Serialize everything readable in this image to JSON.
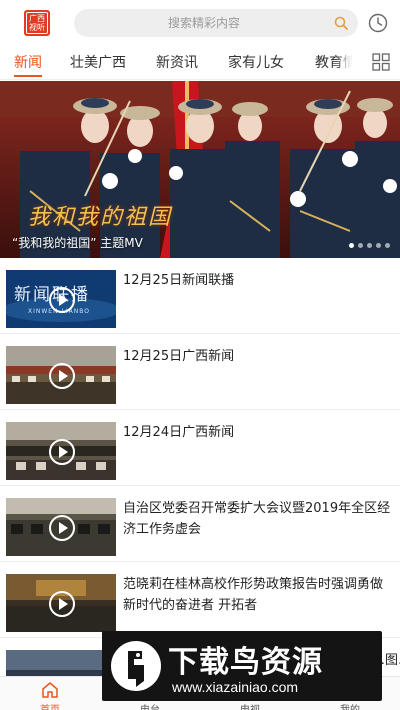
{
  "header": {
    "logo_text": "广西视听",
    "search_placeholder": "搜索精彩内容",
    "icons": {
      "search": "search-icon",
      "history": "clock-icon",
      "menu": "grid-icon"
    }
  },
  "tabs": [
    {
      "label": "新闻",
      "active": true
    },
    {
      "label": "壮美广西",
      "active": false
    },
    {
      "label": "新资讯",
      "active": false
    },
    {
      "label": "家有儿女",
      "active": false
    },
    {
      "label": "教育情",
      "active": false
    }
  ],
  "banner": {
    "caption": "“我和我的祖国” 主题MV",
    "artwork_text": "我和我的祖国",
    "slide_count": 5,
    "active_slide": 1
  },
  "news": [
    {
      "title": "12月25日新闻联播",
      "thumb_text": "新闻联播",
      "thumb_subtext": "XINWEN LIANBO"
    },
    {
      "title": "12月25日广西新闻"
    },
    {
      "title": "12月24日广西新闻"
    },
    {
      "title": "自治区党委召开常委扩大会议暨2019年全区经济工作务虚会"
    },
    {
      "title": "范晓莉在桂林高校作形势政策报告时强调勇做新时代的奋进者 开拓者"
    },
    {
      "title": "…图…"
    }
  ],
  "bottom_nav": [
    {
      "label": "首页",
      "icon": "home-icon",
      "active": true
    },
    {
      "label": "电台",
      "active": false
    },
    {
      "label": "电视",
      "active": false
    },
    {
      "label": "我的",
      "active": false
    }
  ],
  "watermark": {
    "title": "下载鸟资源",
    "url": "www.xiazainiao.com"
  },
  "colors": {
    "accent": "#e8541d",
    "logo_red": "#e23a24",
    "search_bg": "#eeeeee"
  }
}
